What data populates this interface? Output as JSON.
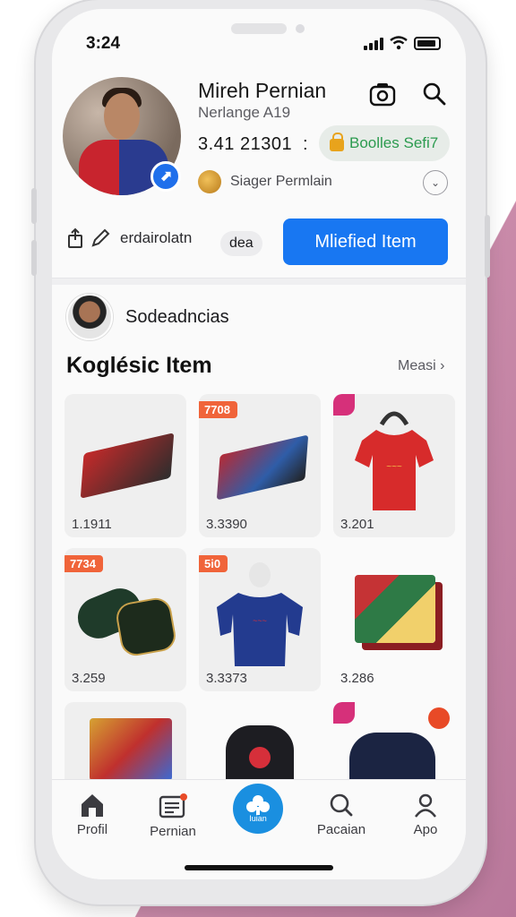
{
  "status_bar": {
    "time": "3:24"
  },
  "profile": {
    "name": "Mireh Pernian",
    "subtitle": "Nerlange A19",
    "stat": "3.41 21301",
    "stat_separator": ":",
    "pill_label": "Boolles Sefi7",
    "follower_label": "Siager Permlain"
  },
  "actions": {
    "label": "erdairolatn",
    "tag": "dea",
    "primary_button": "Mliefied Item"
  },
  "poster": {
    "name": "Sodeadncias"
  },
  "section": {
    "title": "Koglésic Item",
    "link": "Measi"
  },
  "items": [
    {
      "ribbon": "",
      "price": "1.1911"
    },
    {
      "ribbon": "7708",
      "price": "3.3390"
    },
    {
      "ribbon": "",
      "price": "3.201"
    },
    {
      "ribbon": "7734",
      "price": "3.259"
    },
    {
      "ribbon": "5i0",
      "price": "3.3373"
    },
    {
      "ribbon": "",
      "price": "3.286"
    },
    {
      "ribbon": "",
      "price": ""
    },
    {
      "ribbon": "",
      "price": ""
    },
    {
      "ribbon": "",
      "price": ""
    }
  ],
  "bottom_nav": [
    {
      "label": "Profil",
      "icon": "home-icon"
    },
    {
      "label": "Pernian",
      "icon": "news-icon"
    },
    {
      "label": "Iuian",
      "icon": "club-icon"
    },
    {
      "label": "Pacaian",
      "icon": "search-icon"
    },
    {
      "label": "Apo",
      "icon": "person-icon"
    }
  ],
  "colors": {
    "accent": "#1877f2",
    "ribbon": "#f0643a",
    "ribbon_pink": "#d6307a",
    "nav_center": "#1a8fe0"
  }
}
